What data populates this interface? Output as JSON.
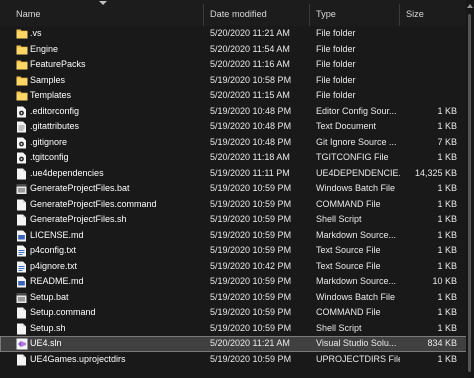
{
  "columns": {
    "name": "Name",
    "date": "Date modified",
    "type": "Type",
    "size": "Size"
  },
  "files": [
    {
      "icon": "folder-icon",
      "name": ".vs",
      "date": "5/20/2020 11:21 AM",
      "type": "File folder",
      "size": ""
    },
    {
      "icon": "folder-icon",
      "name": "Engine",
      "date": "5/20/2020 11:54 AM",
      "type": "File folder",
      "size": ""
    },
    {
      "icon": "folder-icon",
      "name": "FeaturePacks",
      "date": "5/20/2020 11:16 AM",
      "type": "File folder",
      "size": ""
    },
    {
      "icon": "folder-icon",
      "name": "Samples",
      "date": "5/19/2020 10:58 PM",
      "type": "File folder",
      "size": ""
    },
    {
      "icon": "folder-icon",
      "name": "Templates",
      "date": "5/20/2020 11:15 AM",
      "type": "File folder",
      "size": ""
    },
    {
      "icon": "gear-file-icon",
      "name": ".editorconfig",
      "date": "5/19/2020 10:48 PM",
      "type": "Editor Config Sour...",
      "size": "1 KB"
    },
    {
      "icon": "document-icon",
      "name": ".gitattributes",
      "date": "5/19/2020 10:48 PM",
      "type": "Text Document",
      "size": "1 KB"
    },
    {
      "icon": "gear-file-icon",
      "name": ".gitignore",
      "date": "5/19/2020 10:48 PM",
      "type": "Git Ignore Source ...",
      "size": "7 KB"
    },
    {
      "icon": "gear-file-icon",
      "name": ".tgitconfig",
      "date": "5/20/2020 11:18 AM",
      "type": "TGITCONFIG File",
      "size": "1 KB"
    },
    {
      "icon": "blank-file-icon",
      "name": ".ue4dependencies",
      "date": "5/19/2020 11:11 PM",
      "type": "UE4DEPENDENCIE...",
      "size": "14,325 KB"
    },
    {
      "icon": "batch-file-icon",
      "name": "GenerateProjectFiles.bat",
      "date": "5/19/2020 10:59 PM",
      "type": "Windows Batch File",
      "size": "1 KB"
    },
    {
      "icon": "blank-file-icon",
      "name": "GenerateProjectFiles.command",
      "date": "5/19/2020 10:59 PM",
      "type": "COMMAND File",
      "size": "1 KB"
    },
    {
      "icon": "blank-file-icon",
      "name": "GenerateProjectFiles.sh",
      "date": "5/19/2020 10:59 PM",
      "type": "Shell Script",
      "size": "1 KB"
    },
    {
      "icon": "markdown-file-icon",
      "name": "LICENSE.md",
      "date": "5/19/2020 10:59 PM",
      "type": "Markdown Source...",
      "size": "1 KB"
    },
    {
      "icon": "text-file-icon",
      "name": "p4config.txt",
      "date": "5/19/2020 10:59 PM",
      "type": "Text Source File",
      "size": "1 KB"
    },
    {
      "icon": "text-file-icon",
      "name": "p4ignore.txt",
      "date": "5/19/2020 10:42 PM",
      "type": "Text Source File",
      "size": "1 KB"
    },
    {
      "icon": "markdown-file-icon",
      "name": "README.md",
      "date": "5/19/2020 10:59 PM",
      "type": "Markdown Source...",
      "size": "10 KB"
    },
    {
      "icon": "batch-file-icon",
      "name": "Setup.bat",
      "date": "5/19/2020 10:59 PM",
      "type": "Windows Batch File",
      "size": "1 KB"
    },
    {
      "icon": "blank-file-icon",
      "name": "Setup.command",
      "date": "5/19/2020 10:59 PM",
      "type": "COMMAND File",
      "size": "1 KB"
    },
    {
      "icon": "blank-file-icon",
      "name": "Setup.sh",
      "date": "5/19/2020 10:59 PM",
      "type": "Shell Script",
      "size": "1 KB"
    },
    {
      "icon": "visual-studio-solution-icon",
      "name": "UE4.sln",
      "date": "5/20/2020 11:21 AM",
      "type": "Visual Studio Solu...",
      "size": "834 KB",
      "selected": true
    },
    {
      "icon": "blank-file-icon",
      "name": "UE4Games.uprojectdirs",
      "date": "5/19/2020 10:59 PM",
      "type": "UPROJECTDIRS File",
      "size": "1 KB"
    }
  ],
  "colors": {
    "background": "#191919",
    "folder": "#f2c14e",
    "selected_row": "#404040"
  }
}
